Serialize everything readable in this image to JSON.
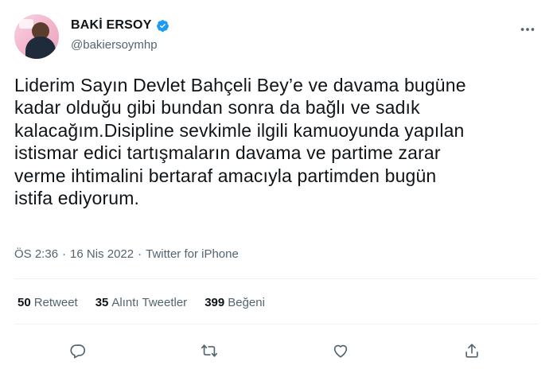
{
  "author": {
    "display_name": "BAKİ ERSOY",
    "handle": "@bakiersoymhp",
    "verified": true,
    "verified_color": "#1d9bf0"
  },
  "tweet": {
    "lines": [
      "Liderim Sayın Devlet Bahçeli Bey’e ve davama bugüne",
      "kadar olduğu gibi bundan sonra da bağlı ve sadık",
      "kalacağım.Disipline sevkimle ilgili kamuoyunda yapılan",
      "istismar edici tartışmaların davama ve partime zarar",
      "verme ihtimalini bertaraf amacıyla partimden bugün",
      "istifa ediyorum."
    ]
  },
  "meta": {
    "time": "ÖS 2:36",
    "sep1": "·",
    "date": "16 Nis 2022",
    "sep2": "·",
    "source": "Twitter for iPhone"
  },
  "stats": [
    {
      "count": "50",
      "label": "Retweet"
    },
    {
      "count": "35",
      "label": "Alıntı Tweetler"
    },
    {
      "count": "399",
      "label": "Beğeni"
    }
  ],
  "actions": [
    "reply-icon",
    "retweet-icon",
    "like-icon",
    "share-icon"
  ],
  "colors": {
    "text": "#0f1419",
    "secondary": "#536471",
    "divider": "#eff3f4",
    "icon": "#536471"
  }
}
